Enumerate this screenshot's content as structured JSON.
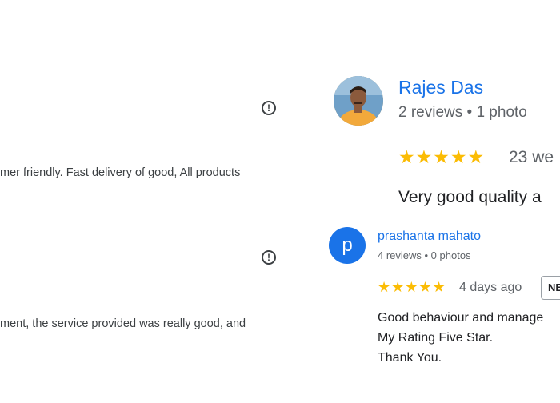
{
  "left": {
    "review1_text": "mer friendly. Fast delivery of good, All products",
    "review2_text": "ment, the service provided was really good, and",
    "report_icon": "exclamation-circle-icon"
  },
  "review_rajes": {
    "name": "Rajes Das",
    "meta": "2 reviews • 1 photo",
    "stars": "★★★★★",
    "time": "23 we",
    "text": "Very good quality a"
  },
  "review_prashanta": {
    "avatar_letter": "p",
    "name": "prashanta mahato",
    "meta": "4 reviews • 0 photos",
    "stars": "★★★★★",
    "time": "4 days ago",
    "badge": "NE",
    "text_line1": "Good behaviour and manage",
    "text_line2": "My Rating Five Star.",
    "text_line3": "Thank You."
  },
  "colors": {
    "accent": "#1a73e8",
    "star": "#fbbc04",
    "text": "#202124",
    "muted": "#5f6368"
  }
}
